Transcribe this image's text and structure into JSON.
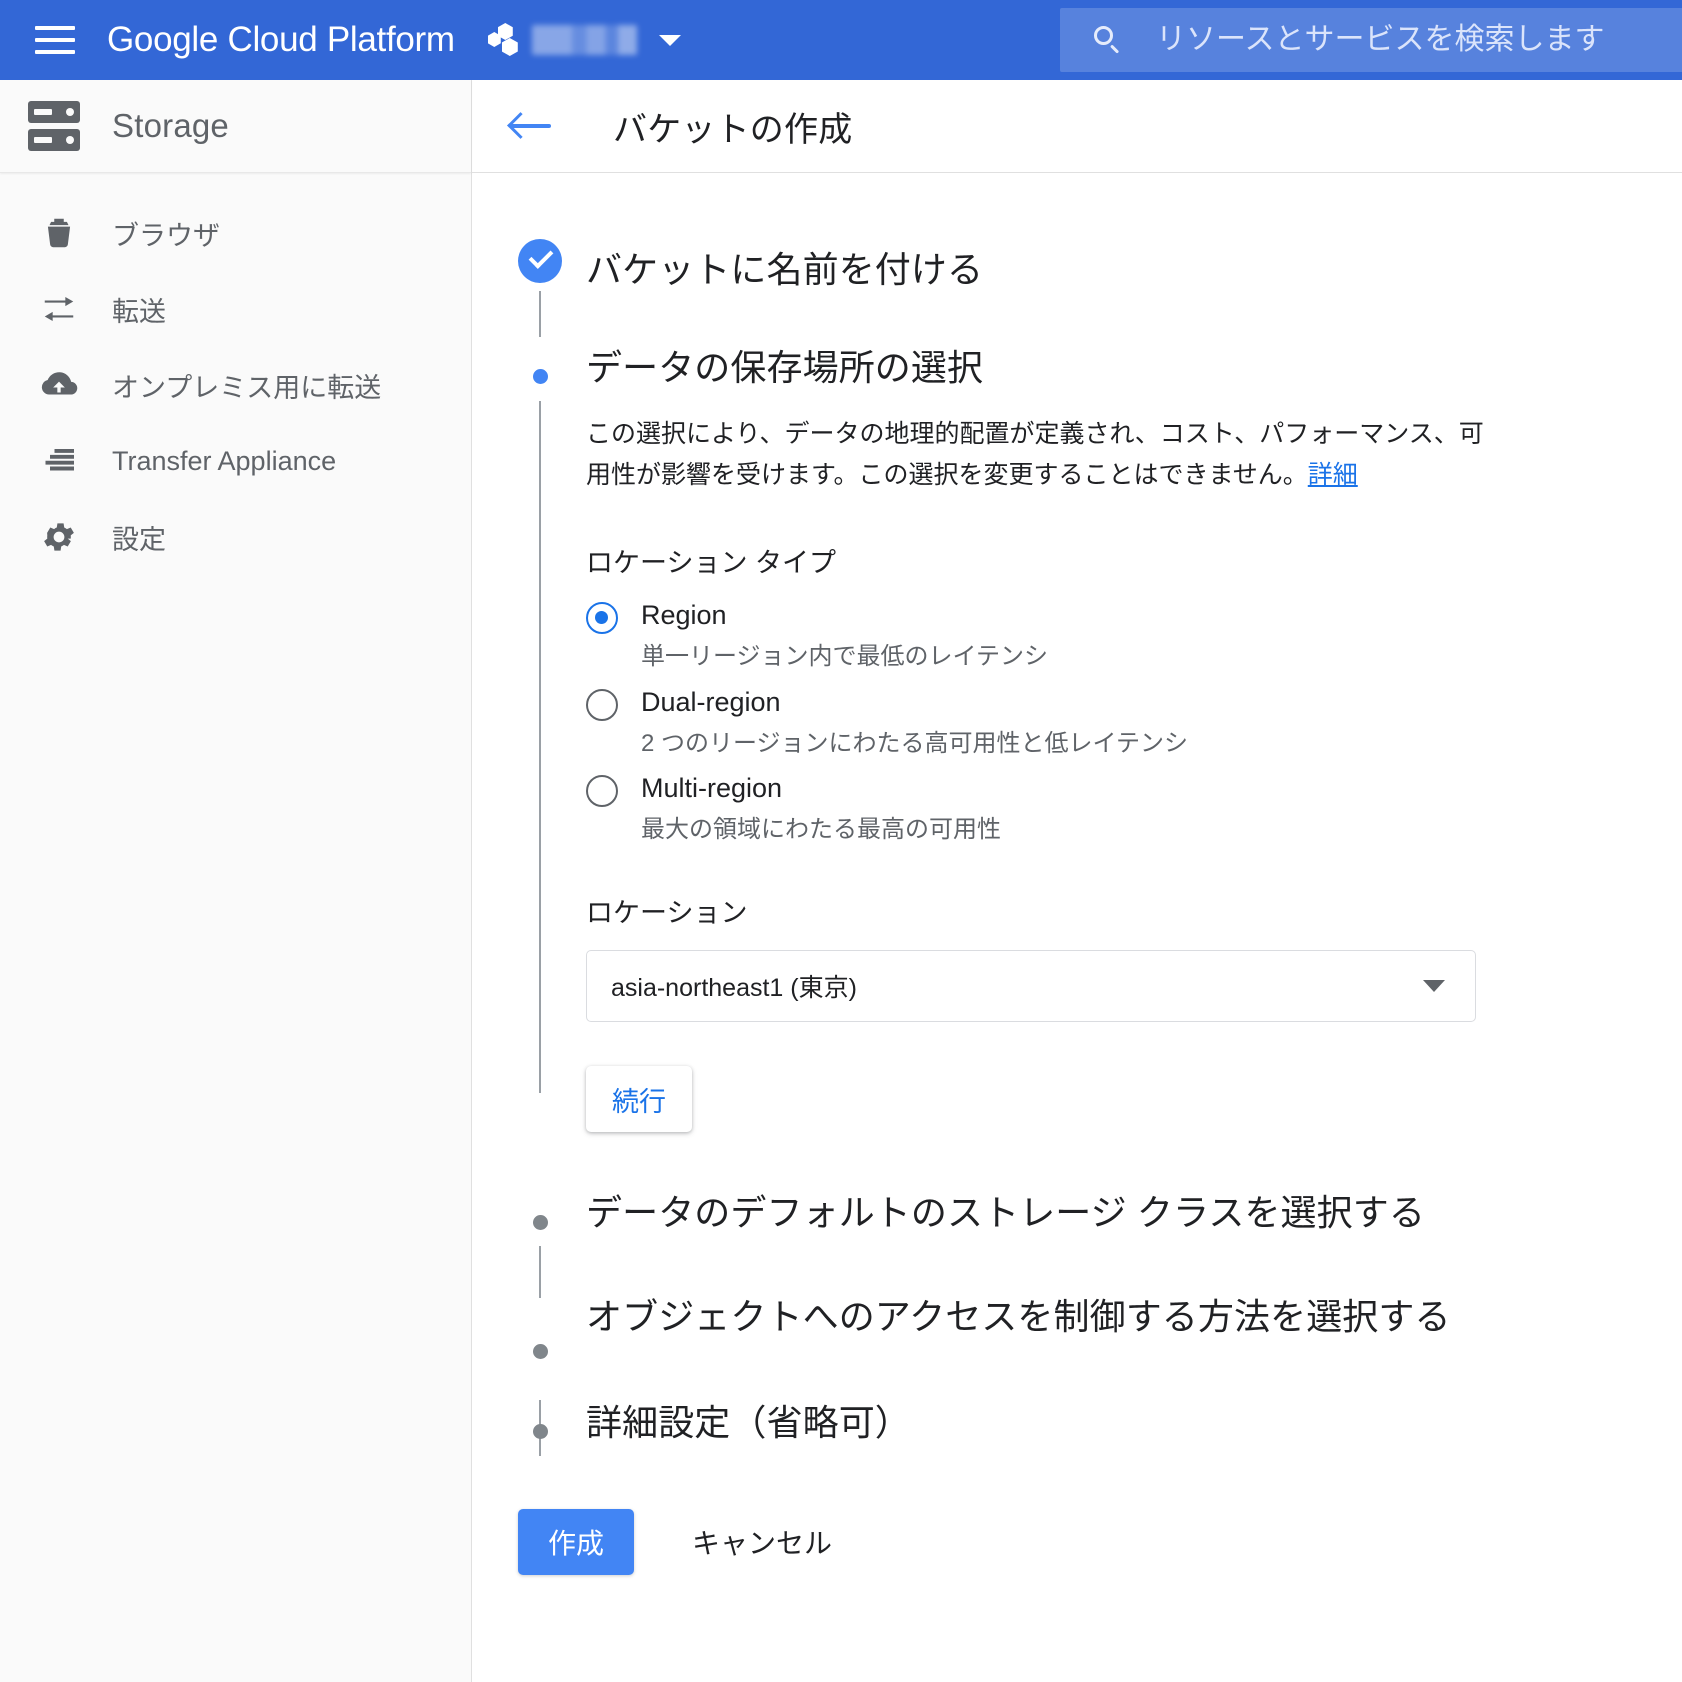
{
  "topbar": {
    "menu_icon": "hamburger-icon",
    "brand": "Google Cloud Platform",
    "project_icon": "project-hexagon-icon",
    "project_name": "",
    "project_caret_icon": "chevron-down-icon",
    "search": {
      "icon": "search-icon",
      "placeholder": "リソースとサービスを検索します",
      "value": ""
    },
    "accent_color": "#3367d6"
  },
  "sidebar": {
    "product_icon": "storage-icon",
    "product_name": "Storage",
    "items": [
      {
        "icon": "bucket-icon",
        "label": "ブラウザ"
      },
      {
        "icon": "transfer-icon",
        "label": "転送"
      },
      {
        "icon": "cloud-upload-icon",
        "label": "オンプレミス用に転送"
      },
      {
        "icon": "appliance-list-icon",
        "label": "Transfer Appliance"
      },
      {
        "icon": "gear-icon",
        "label": "設定"
      }
    ]
  },
  "page": {
    "back_icon": "arrow-left-icon",
    "title": "バケットの作成"
  },
  "steps": [
    {
      "state": "done",
      "bullet_icon": "check-circle-icon",
      "title": "バケットに名前を付ける"
    },
    {
      "state": "active",
      "bullet_icon": "dot-icon",
      "title": "データの保存場所の選択",
      "description": "この選択により、データの地理的配置が定義され、コスト、パフォーマンス、可用性が影響を受けます。この選択を変更することはできません。",
      "description_link": "詳細",
      "location_type_label": "ロケーション タイプ",
      "options": [
        {
          "value": "region",
          "label": "Region",
          "description": "単一リージョン内で最低のレイテンシ",
          "selected": true
        },
        {
          "value": "dual-region",
          "label": "Dual-region",
          "description": "2 つのリージョンにわたる高可用性と低レイテンシ",
          "selected": false
        },
        {
          "value": "multi-region",
          "label": "Multi-region",
          "description": "最大の領域にわたる最高の可用性",
          "selected": false
        }
      ],
      "location_label": "ロケーション",
      "location_selected": "asia-northeast1 (東京)",
      "location_caret_icon": "chevron-down-icon",
      "continue_label": "続行"
    },
    {
      "state": "idle",
      "bullet_icon": "dot-icon",
      "title": "データのデフォルトのストレージ クラスを選択する"
    },
    {
      "state": "idle",
      "bullet_icon": "dot-icon",
      "title": "オブジェクトへのアクセスを制御する方法を選択する"
    },
    {
      "state": "idle",
      "bullet_icon": "dot-icon",
      "title": "詳細設定（省略可）"
    }
  ],
  "actions": {
    "create_label": "作成",
    "cancel_label": "キャンセル",
    "create_color": "#4285f4"
  }
}
